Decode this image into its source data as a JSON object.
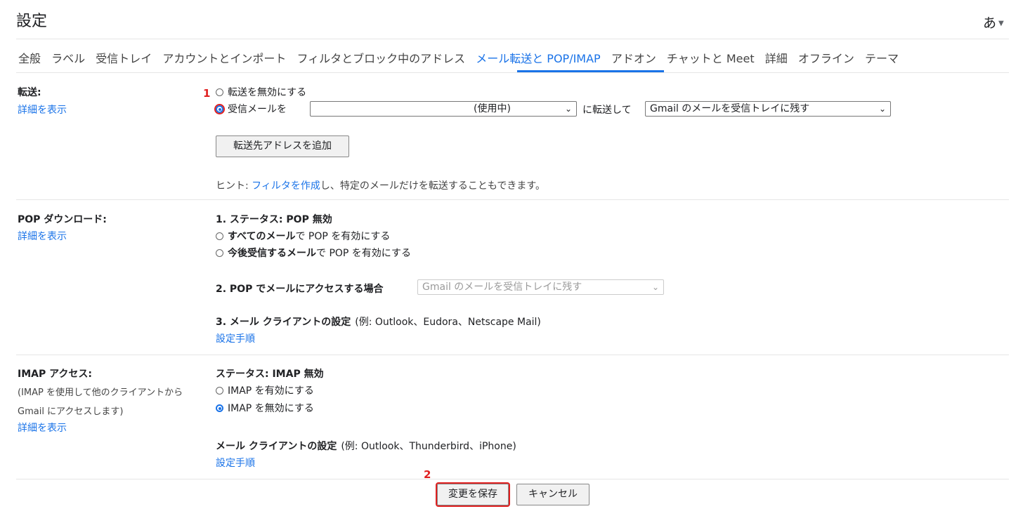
{
  "header": {
    "title": "設定",
    "lang_label": "あ"
  },
  "tabs": [
    {
      "label": "全般"
    },
    {
      "label": "ラベル"
    },
    {
      "label": "受信トレイ"
    },
    {
      "label": "アカウントとインポート"
    },
    {
      "label": "フィルタとブロック中のアドレス"
    },
    {
      "label": "メール転送と POP/IMAP"
    },
    {
      "label": "アドオン"
    },
    {
      "label": "チャットと Meet"
    },
    {
      "label": "詳細"
    },
    {
      "label": "オフライン"
    },
    {
      "label": "テーマ"
    }
  ],
  "forwarding": {
    "label": "転送:",
    "details_link": "詳細を表示",
    "disable_option": "転送を無効にする",
    "forward_prefix": "受信メールを",
    "address_select_value": "(使用中)",
    "forward_mid": "に転送して",
    "action_select_value": "Gmail のメールを受信トレイに残す",
    "add_address_button": "転送先アドレスを追加",
    "hint_prefix": "ヒント: ",
    "hint_link": "フィルタを作成",
    "hint_suffix": "し、特定のメールだけを転送することもできます。"
  },
  "pop": {
    "label": "POP ダウンロード:",
    "details_link": "詳細を表示",
    "status": "1. ステータス: POP 無効",
    "option_all_bold": "すべてのメール",
    "option_all_rest": "で POP を有効にする",
    "option_new_bold": "今後受信するメール",
    "option_new_rest": "で POP を有効にする",
    "access_label": "2. POP でメールにアクセスする場合",
    "access_select_value": "Gmail のメールを受信トレイに残す",
    "client_label": "3. メール クライアントの設定",
    "client_examples": "(例: Outlook、Eudora、Netscape Mail)",
    "setup_link": "設定手順"
  },
  "imap": {
    "label": "IMAP アクセス:",
    "desc_line1": "(IMAP を使用して他のクライアントから",
    "desc_line2": "Gmail にアクセスします)",
    "details_link": "詳細を表示",
    "status": "ステータス: IMAP 無効",
    "enable_option": "IMAP を有効にする",
    "disable_option": "IMAP を無効にする",
    "client_label": "メール クライアントの設定",
    "client_examples": "(例: Outlook、Thunderbird、iPhone)",
    "setup_link": "設定手順"
  },
  "footer": {
    "save_button": "変更を保存",
    "cancel_button": "キャンセル"
  },
  "annotations": {
    "marker1": "1",
    "marker2": "2"
  },
  "colors": {
    "accent": "#1a73e8",
    "highlight": "#e02020"
  }
}
